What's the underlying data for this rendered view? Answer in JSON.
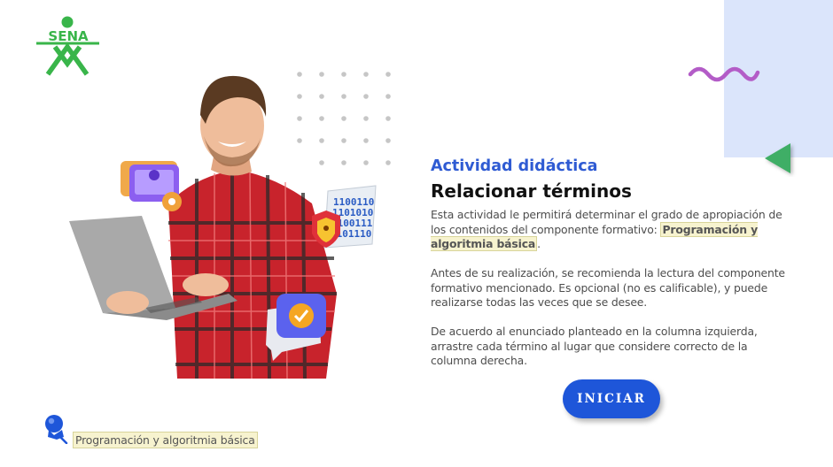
{
  "logo": {
    "text": "SENA",
    "color": "#39b54a"
  },
  "activity": {
    "kicker": "Actividad didáctica",
    "title": "Relacionar términos",
    "p1_before": "Esta actividad le permitirá determinar el grado de apropiación de los contenidos del componente formativo: ",
    "p1_highlight": "Programación y algoritmia básica",
    "p1_after": ".",
    "p2": "Antes de su realización, se recomienda la lectura del componente formativo mencionado.  Es opcional (no es calificable), y puede realizarse todas las veces que se desee.",
    "p3": "De acuerdo al enunciado planteado en la columna izquierda, arrastre cada término al lugar que considere correcto de la columna derecha."
  },
  "start_button": {
    "label": "INICIAR"
  },
  "footer": {
    "course_label": "Programación y algoritmia básica"
  },
  "hero": {
    "binary_lines": [
      "1100110",
      "1101010",
      "1100111",
      "1101110"
    ]
  },
  "colors": {
    "accent": "#1e56d9",
    "kicker": "#2f5bd3",
    "panel": "#dbe5fb",
    "squiggle": "#b35cc7",
    "triangle": "#3fae66"
  }
}
